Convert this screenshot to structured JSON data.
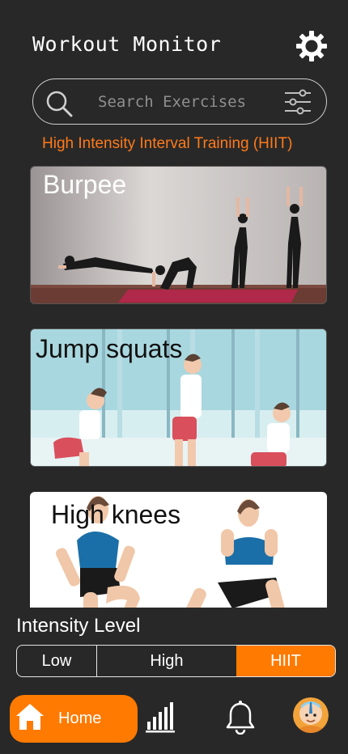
{
  "header": {
    "title": "Workout Monitor"
  },
  "icons": {
    "settings": "gear-icon",
    "search": "search-icon",
    "filter": "sliders-icon",
    "home": "home-icon",
    "stats": "bar-chart-icon",
    "notifications": "bell-icon"
  },
  "search": {
    "placeholder": "Search Exercises"
  },
  "category": "High Intensity Interval Training (HIIT)",
  "exercises": [
    {
      "name": "Burpee"
    },
    {
      "name": "Jump squats"
    },
    {
      "name": "High knees"
    }
  ],
  "intensity": {
    "label": "Intensity Level",
    "options": [
      "Low",
      "High",
      "HIIT"
    ],
    "selected": "HIIT"
  },
  "nav": {
    "home_label": "Home"
  },
  "colors": {
    "accent": "#ff7a00",
    "background": "#282828",
    "category_text": "#ff7a1a"
  }
}
